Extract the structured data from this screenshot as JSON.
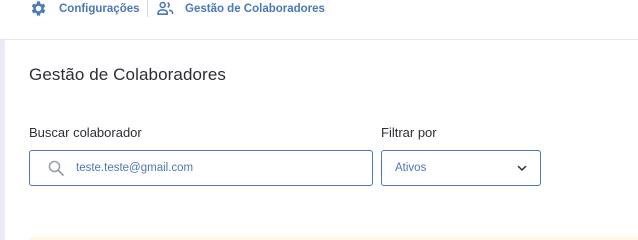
{
  "breadcrumb": {
    "items": [
      {
        "label": "Configurações",
        "icon": "gear-icon"
      },
      {
        "label": "Gestão de Colaboradores",
        "icon": "users-icon"
      }
    ]
  },
  "page": {
    "title": "Gestão de Colaboradores"
  },
  "search": {
    "label": "Buscar colaborador",
    "value": "teste.teste@gmail.com",
    "icon": "search-icon"
  },
  "filter": {
    "label": "Filtrar por",
    "selected": "Ativos",
    "icon": "chevron-down-icon"
  },
  "colors": {
    "accent": "#4a78b8",
    "text": "#2c2f36",
    "background": "#f3f2f8"
  }
}
